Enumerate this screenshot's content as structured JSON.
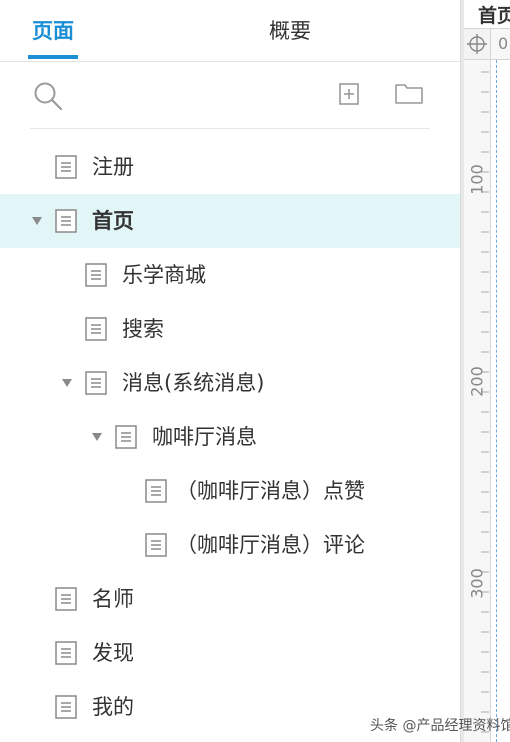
{
  "tabs": {
    "pages": "页面",
    "overview": "概要"
  },
  "toolbar": {
    "search_icon": "search-icon",
    "add_page_icon": "add-page-icon",
    "add_folder_icon": "add-folder-icon"
  },
  "tree": [
    {
      "label": "注册",
      "expanded": null,
      "selected": false
    },
    {
      "label": "首页",
      "expanded": true,
      "selected": true
    },
    {
      "label": "乐学商城",
      "expanded": null,
      "selected": false
    },
    {
      "label": "搜索",
      "expanded": null,
      "selected": false
    },
    {
      "label": "消息(系统消息)",
      "expanded": true,
      "selected": false
    },
    {
      "label": "咖啡厅消息",
      "expanded": true,
      "selected": false
    },
    {
      "label": "（咖啡厅消息）点赞",
      "expanded": null,
      "selected": false
    },
    {
      "label": "（咖啡厅消息）评论",
      "expanded": null,
      "selected": false
    },
    {
      "label": "名师",
      "expanded": null,
      "selected": false
    },
    {
      "label": "发现",
      "expanded": null,
      "selected": false
    },
    {
      "label": "我的",
      "expanded": null,
      "selected": false
    }
  ],
  "canvas": {
    "tab_label": "首页",
    "ruler_top_label": "0",
    "ruler_marks": [
      "100",
      "200",
      "300"
    ]
  },
  "watermark": "头条 @产品经理资料馆",
  "colors": {
    "accent": "#1a8fd6",
    "selected_row": "#e2f5f7",
    "text": "#333333"
  }
}
